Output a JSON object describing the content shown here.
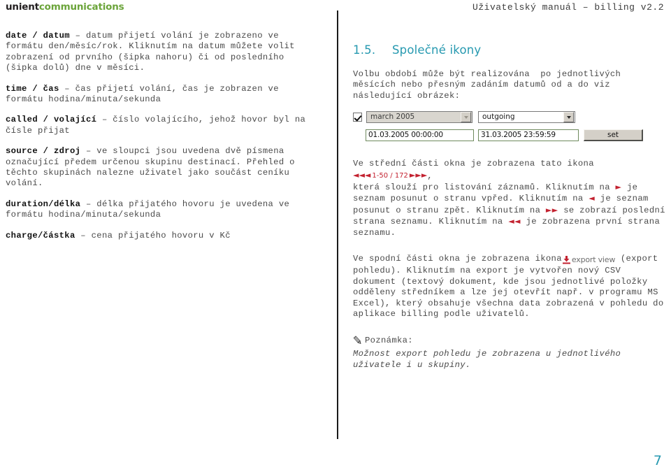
{
  "header": {
    "logo_part1": "unient",
    "logo_part2": "communications",
    "manual_title": "Uživatelský manuál – billing v2.2"
  },
  "left_column": {
    "entries": [
      {
        "term": "date / datum",
        "text": " – datum přijetí volání je zobrazeno ve\nformátu den/měsíc/rok. Kliknutím na datum můžete volit\nzobrazení od prvního (šipka nahoru) či od posledního\n(šipka dolů) dne v měsíci."
      },
      {
        "term": "time / čas",
        "text": " – čas přijetí volání, čas je zobrazen ve\nformátu hodina/minuta/sekunda"
      },
      {
        "term": "called / volající",
        "text": " – číslo volajícího, jehož hovor byl na\nčísle přijat"
      },
      {
        "term": "source / zdroj",
        "text": " – ve sloupci jsou uvedena dvě písmena\noznačující předem určenou skupinu destinací. Přehled o\ntěchto skupinách nalezne uživatel jako součást ceníku\nvolání."
      },
      {
        "term": "duration/délka",
        "text": " – délka přijatého hovoru je uvedena ve\nformátu hodina/minuta/sekunda"
      },
      {
        "term": "charge/částka",
        "text": " – cena přijatého hovoru v Kč"
      }
    ]
  },
  "right_column": {
    "section_number": "1.5.",
    "section_title": "Společné ikony",
    "intro": "Volbu období může být realizována  po jednotlivých\nměsících nebo přesným zadáním datumů od a do viz\nnásledující obrázek:",
    "widget": {
      "checkbox_checked": true,
      "month_select_value": "march 2005",
      "direction_select_value": "outgoing",
      "date_from": "01.03.2005 00:00:00",
      "date_to": "31.03.2005 23:59:59",
      "set_button_label": "set"
    },
    "pager_paragraph": {
      "lead": "Ve střední části okna je zobrazena tato ikona ",
      "pager_first": "◄◄",
      "pager_prev": "◄",
      "pager_label": "1-50 / 172",
      "pager_next": "►",
      "pager_last": "►►",
      "after_icon": ",",
      "rest_1": "která slouží pro listování záznamů. Kliknutím na ",
      "glyph_next": "►",
      "rest_2": " je\nseznam posunut o stranu vpřed. Kliknutím na ",
      "glyph_prev": "◄",
      "rest_3": " je seznam\nposunut o stranu zpět. Kliknutím na ",
      "glyph_last": "►►",
      "rest_4": " se zobrazí poslední\nstrana seznamu. Kliknutím na ",
      "glyph_first": "◄◄",
      "rest_5": " je zobrazena první strana\nseznamu."
    },
    "export_paragraph": {
      "lead": "Ve spodní části okna je zobrazena ikona",
      "export_icon_label": "export view",
      "rest": " (export\npohledu). Kliknutím na export je vytvořen nový CSV\ndokument (textový dokument, kde jsou jednotlivé položky\nodděleny středníkem a lze jej otevřít např. v programu MS\nExcel), který obsahuje všechna data zobrazená v pohledu do\naplikace billing podle uživatelů."
    },
    "note": {
      "title": "Poznámka:",
      "text": "Možnost export pohledu je zobrazena u jednotlivého\nuživatele i u skupiny."
    }
  },
  "footer": {
    "page_number": "7"
  },
  "colors": {
    "brand_green": "#6ba43a",
    "heading_teal": "#2699b0",
    "icon_red": "#c32230",
    "body_gray": "#4a4a4a"
  }
}
